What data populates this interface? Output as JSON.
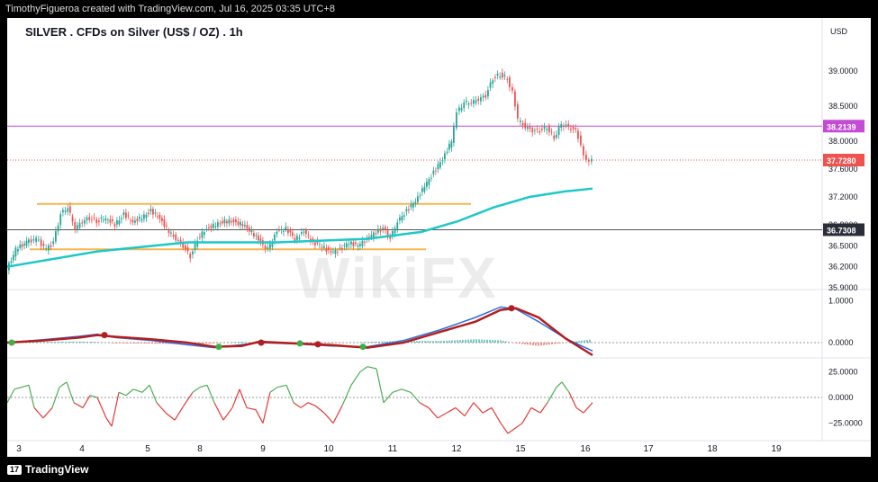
{
  "header": {
    "attribution": "TimothyFigueroa created with TradingView.com, Jul 16, 2025 03:35 UTC+8"
  },
  "footer": {
    "brand": "TradingView"
  },
  "watermark": "WikiFX",
  "colors": {
    "up": "#26a69a",
    "down": "#ef5350",
    "ma": "#1ec8c8",
    "macd": "#2b6ee0",
    "signal": "#b31e1e",
    "signal_up": "#3cb043",
    "zone": "#f7b54d",
    "resistance": "#c34bd6",
    "support": "#555555"
  },
  "chart_data": {
    "type": "candlestick",
    "title": "SILVER . CFDs on Silver (US$ / OZ) . 1h",
    "currency_label": "USD",
    "x_ticks": [
      "3",
      "4",
      "5",
      "8",
      "9",
      "10",
      "11",
      "12",
      "15",
      "16",
      "17",
      "18",
      "19"
    ],
    "price_panel": {
      "ylim": [
        35.9,
        39.35
      ],
      "y_ticks": [
        "39.0000",
        "38.5000",
        "38.0000",
        "37.6000",
        "37.2000",
        "36.8000",
        "36.5000",
        "36.2000",
        "35.9000"
      ],
      "tick_values": [
        39.0,
        38.5,
        38.0,
        37.6,
        37.2,
        36.8,
        36.5,
        36.2,
        35.9
      ],
      "price_path": [
        [
          0,
          36.15
        ],
        [
          10,
          36.45
        ],
        [
          22,
          36.55
        ],
        [
          33,
          36.6
        ],
        [
          44,
          36.45
        ],
        [
          52,
          36.55
        ],
        [
          60,
          36.95
        ],
        [
          68,
          37.05
        ],
        [
          76,
          36.75
        ],
        [
          84,
          36.85
        ],
        [
          92,
          36.9
        ],
        [
          100,
          36.85
        ],
        [
          110,
          36.9
        ],
        [
          120,
          36.8
        ],
        [
          130,
          36.95
        ],
        [
          140,
          36.85
        ],
        [
          150,
          36.9
        ],
        [
          160,
          37.0
        ],
        [
          170,
          36.9
        ],
        [
          180,
          36.7
        ],
        [
          188,
          36.6
        ],
        [
          196,
          36.5
        ],
        [
          204,
          36.35
        ],
        [
          212,
          36.6
        ],
        [
          222,
          36.75
        ],
        [
          232,
          36.8
        ],
        [
          242,
          36.85
        ],
        [
          252,
          36.85
        ],
        [
          262,
          36.8
        ],
        [
          272,
          36.7
        ],
        [
          282,
          36.55
        ],
        [
          290,
          36.45
        ],
        [
          300,
          36.7
        ],
        [
          310,
          36.75
        ],
        [
          320,
          36.6
        ],
        [
          330,
          36.7
        ],
        [
          340,
          36.55
        ],
        [
          350,
          36.5
        ],
        [
          360,
          36.4
        ],
        [
          370,
          36.45
        ],
        [
          380,
          36.55
        ],
        [
          390,
          36.5
        ],
        [
          400,
          36.6
        ],
        [
          410,
          36.7
        ],
        [
          418,
          36.75
        ],
        [
          426,
          36.6
        ],
        [
          434,
          36.85
        ],
        [
          444,
          37.0
        ],
        [
          454,
          37.15
        ],
        [
          464,
          37.35
        ],
        [
          474,
          37.55
        ],
        [
          484,
          37.75
        ],
        [
          494,
          38.0
        ],
        [
          500,
          38.4
        ],
        [
          508,
          38.55
        ],
        [
          516,
          38.55
        ],
        [
          524,
          38.6
        ],
        [
          532,
          38.65
        ],
        [
          540,
          38.9
        ],
        [
          548,
          38.95
        ],
        [
          556,
          38.9
        ],
        [
          562,
          38.7
        ],
        [
          568,
          38.3
        ],
        [
          576,
          38.2
        ],
        [
          584,
          38.15
        ],
        [
          592,
          38.15
        ],
        [
          600,
          38.2
        ],
        [
          608,
          38.05
        ],
        [
          616,
          38.25
        ],
        [
          624,
          38.2
        ],
        [
          632,
          38.15
        ],
        [
          638,
          37.95
        ],
        [
          644,
          37.7
        ],
        [
          650,
          37.72
        ]
      ],
      "ma": [
        [
          0,
          36.2
        ],
        [
          100,
          36.42
        ],
        [
          200,
          36.55
        ],
        [
          300,
          36.55
        ],
        [
          400,
          36.6
        ],
        [
          460,
          36.7
        ],
        [
          500,
          36.85
        ],
        [
          540,
          37.05
        ],
        [
          580,
          37.2
        ],
        [
          620,
          37.28
        ],
        [
          650,
          37.32
        ]
      ],
      "zones": [
        {
          "from_x": 33,
          "to_x": 515,
          "value": 37.1
        },
        {
          "from_x": 25,
          "to_x": 465,
          "value": 36.45
        }
      ],
      "resistance": {
        "value": 38.2139,
        "label": "38.2139"
      },
      "current": {
        "value": 37.728,
        "label": "37.7280"
      },
      "support": {
        "value": 36.7308,
        "label": "36.7308"
      }
    },
    "macd_panel": {
      "ylim": [
        -0.3,
        1.2
      ],
      "y_ticks": [
        "1.0000",
        "0.0000"
      ],
      "tick_values": [
        1.0,
        0.0
      ],
      "macd": [
        [
          0,
          0.0
        ],
        [
          40,
          0.07
        ],
        [
          80,
          0.15
        ],
        [
          100,
          0.2
        ],
        [
          120,
          0.12
        ],
        [
          160,
          0.05
        ],
        [
          200,
          -0.05
        ],
        [
          230,
          -0.12
        ],
        [
          260,
          -0.05
        ],
        [
          280,
          0.0
        ],
        [
          320,
          -0.03
        ],
        [
          360,
          -0.08
        ],
        [
          400,
          -0.1
        ],
        [
          440,
          0.05
        ],
        [
          480,
          0.3
        ],
        [
          520,
          0.6
        ],
        [
          548,
          0.85
        ],
        [
          565,
          0.8
        ],
        [
          590,
          0.5
        ],
        [
          620,
          0.1
        ],
        [
          650,
          -0.2
        ]
      ],
      "signal": [
        [
          0,
          0.0
        ],
        [
          40,
          0.05
        ],
        [
          80,
          0.12
        ],
        [
          100,
          0.18
        ],
        [
          120,
          0.14
        ],
        [
          160,
          0.08
        ],
        [
          200,
          0.0
        ],
        [
          230,
          -0.1
        ],
        [
          260,
          -0.08
        ],
        [
          280,
          0.02
        ],
        [
          320,
          -0.02
        ],
        [
          360,
          -0.06
        ],
        [
          400,
          -0.12
        ],
        [
          440,
          0.0
        ],
        [
          480,
          0.25
        ],
        [
          520,
          0.5
        ],
        [
          548,
          0.78
        ],
        [
          565,
          0.82
        ],
        [
          590,
          0.6
        ],
        [
          620,
          0.1
        ],
        [
          650,
          -0.3
        ]
      ],
      "cross_points": [
        [
          5,
          0.0,
          "up"
        ],
        [
          108,
          0.18,
          "down"
        ],
        [
          235,
          -0.1,
          "up"
        ],
        [
          282,
          0.0,
          "down"
        ],
        [
          325,
          -0.02,
          "up"
        ],
        [
          345,
          -0.04,
          "down"
        ],
        [
          395,
          -0.1,
          "up"
        ],
        [
          560,
          0.82,
          "down"
        ]
      ]
    },
    "osc_panel": {
      "ylim": [
        -35,
        35
      ],
      "y_ticks": [
        "25.0000",
        "0.0000",
        "−25.0000"
      ],
      "tick_values": [
        25,
        0,
        -25
      ],
      "series": [
        [
          0,
          -5
        ],
        [
          8,
          8
        ],
        [
          16,
          10
        ],
        [
          24,
          12
        ],
        [
          30,
          -10
        ],
        [
          40,
          -20
        ],
        [
          50,
          -10
        ],
        [
          58,
          10
        ],
        [
          66,
          15
        ],
        [
          74,
          -5
        ],
        [
          84,
          -10
        ],
        [
          92,
          2
        ],
        [
          100,
          0
        ],
        [
          110,
          -20
        ],
        [
          116,
          -28
        ],
        [
          124,
          5
        ],
        [
          132,
          2
        ],
        [
          140,
          8
        ],
        [
          150,
          5
        ],
        [
          158,
          12
        ],
        [
          166,
          -5
        ],
        [
          176,
          -15
        ],
        [
          186,
          -22
        ],
        [
          196,
          -8
        ],
        [
          206,
          5
        ],
        [
          214,
          10
        ],
        [
          222,
          12
        ],
        [
          230,
          -5
        ],
        [
          240,
          -22
        ],
        [
          250,
          -10
        ],
        [
          258,
          8
        ],
        [
          266,
          -10
        ],
        [
          276,
          -12
        ],
        [
          284,
          -25
        ],
        [
          292,
          5
        ],
        [
          300,
          10
        ],
        [
          310,
          12
        ],
        [
          318,
          -5
        ],
        [
          326,
          -10
        ],
        [
          334,
          -5
        ],
        [
          342,
          -8
        ],
        [
          352,
          -15
        ],
        [
          362,
          -25
        ],
        [
          372,
          -8
        ],
        [
          382,
          12
        ],
        [
          392,
          25
        ],
        [
          400,
          30
        ],
        [
          410,
          28
        ],
        [
          418,
          -5
        ],
        [
          428,
          5
        ],
        [
          438,
          8
        ],
        [
          448,
          5
        ],
        [
          458,
          -5
        ],
        [
          468,
          -10
        ],
        [
          478,
          -20
        ],
        [
          488,
          -15
        ],
        [
          498,
          -10
        ],
        [
          508,
          -18
        ],
        [
          518,
          -5
        ],
        [
          528,
          -15
        ],
        [
          538,
          -10
        ],
        [
          548,
          -25
        ],
        [
          556,
          -35
        ],
        [
          564,
          -30
        ],
        [
          572,
          -25
        ],
        [
          582,
          -10
        ],
        [
          592,
          -15
        ],
        [
          600,
          -5
        ],
        [
          610,
          10
        ],
        [
          616,
          15
        ],
        [
          624,
          5
        ],
        [
          632,
          -10
        ],
        [
          640,
          -15
        ],
        [
          650,
          -5
        ]
      ]
    }
  }
}
